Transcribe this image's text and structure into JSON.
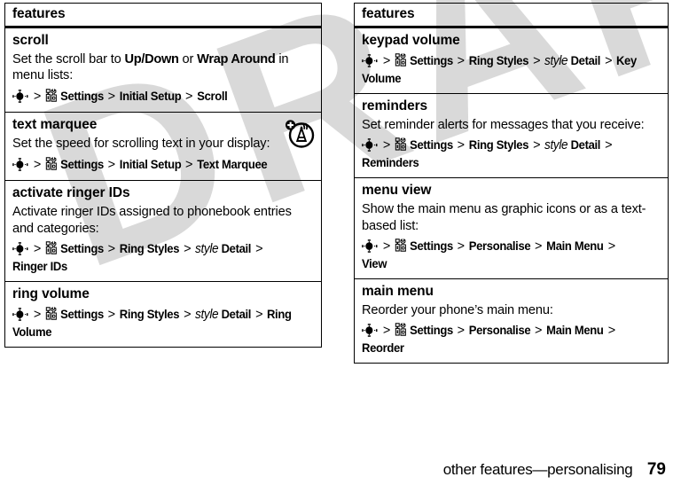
{
  "watermark": {
    "text": "DRAFT"
  },
  "footer": {
    "chapter": "other features—personalising",
    "page_number": "79"
  },
  "icons": {
    "nav_key": "navigation-key-icon",
    "settings": "settings-tools-icon",
    "corner_antenna": "ringer-id-antenna-icon"
  },
  "columns": [
    {
      "header": "features",
      "rows": [
        {
          "title": "scroll",
          "desc_parts": [
            {
              "t": "Set the scroll bar to ",
              "bold": false
            },
            {
              "t": "Up/Down",
              "bold": true
            },
            {
              "t": " or ",
              "bold": false
            },
            {
              "t": "Wrap Around",
              "bold": true
            },
            {
              "t": " in menu lists:",
              "bold": false
            }
          ],
          "path": [
            {
              "type": "navicon"
            },
            {
              "type": "sep",
              "t": ">"
            },
            {
              "type": "toolsicon"
            },
            {
              "type": "label",
              "t": "Settings"
            },
            {
              "type": "sep",
              "t": ">"
            },
            {
              "type": "label",
              "t": "Initial Setup"
            },
            {
              "type": "sep",
              "t": ">"
            },
            {
              "type": "label",
              "t": "Scroll"
            }
          ],
          "corner_icon": false
        },
        {
          "title": "text marquee",
          "desc_parts": [
            {
              "t": "Set the speed for scrolling text in your display:",
              "bold": false
            }
          ],
          "path": [
            {
              "type": "navicon"
            },
            {
              "type": "sep",
              "t": ">"
            },
            {
              "type": "toolsicon"
            },
            {
              "type": "label",
              "t": "Settings"
            },
            {
              "type": "sep",
              "t": ">"
            },
            {
              "type": "label",
              "t": "Initial Setup"
            },
            {
              "type": "sep",
              "t": ">"
            },
            {
              "type": "label",
              "t": "Text Marquee"
            }
          ],
          "corner_icon": true
        },
        {
          "title": "activate ringer IDs",
          "desc_parts": [
            {
              "t": "Activate ringer IDs assigned to phonebook entries and categories:",
              "bold": false
            }
          ],
          "path": [
            {
              "type": "navicon"
            },
            {
              "type": "sep",
              "t": ">"
            },
            {
              "type": "toolsicon"
            },
            {
              "type": "label",
              "t": "Settings"
            },
            {
              "type": "sep",
              "t": ">"
            },
            {
              "type": "label",
              "t": "Ring Styles"
            },
            {
              "type": "sep",
              "t": ">"
            },
            {
              "type": "italic",
              "t": "style"
            },
            {
              "type": "label",
              "t": "Detail"
            },
            {
              "type": "sep",
              "t": ">"
            },
            {
              "type": "label",
              "t": "Ringer IDs"
            }
          ],
          "corner_icon": false
        },
        {
          "title": "ring volume",
          "desc_parts": [],
          "path": [
            {
              "type": "navicon"
            },
            {
              "type": "sep",
              "t": ">"
            },
            {
              "type": "toolsicon"
            },
            {
              "type": "label",
              "t": "Settings"
            },
            {
              "type": "sep",
              "t": ">"
            },
            {
              "type": "label",
              "t": "Ring Styles"
            },
            {
              "type": "sep",
              "t": ">"
            },
            {
              "type": "italic",
              "t": "style"
            },
            {
              "type": "label",
              "t": "Detail"
            },
            {
              "type": "sep",
              "t": ">"
            },
            {
              "type": "label",
              "t": "Ring Volume"
            }
          ],
          "corner_icon": false
        }
      ]
    },
    {
      "header": "features",
      "rows": [
        {
          "title": "keypad volume",
          "desc_parts": [],
          "path": [
            {
              "type": "navicon"
            },
            {
              "type": "sep",
              "t": ">"
            },
            {
              "type": "toolsicon"
            },
            {
              "type": "label",
              "t": "Settings"
            },
            {
              "type": "sep",
              "t": ">"
            },
            {
              "type": "label",
              "t": "Ring Styles"
            },
            {
              "type": "sep",
              "t": ">"
            },
            {
              "type": "italic",
              "t": "style"
            },
            {
              "type": "label",
              "t": "Detail"
            },
            {
              "type": "sep",
              "t": ">"
            },
            {
              "type": "label",
              "t": "Key Volume"
            }
          ],
          "corner_icon": false
        },
        {
          "title": "reminders",
          "desc_parts": [
            {
              "t": "Set reminder alerts for messages that you receive:",
              "bold": false
            }
          ],
          "path": [
            {
              "type": "navicon"
            },
            {
              "type": "sep",
              "t": ">"
            },
            {
              "type": "toolsicon"
            },
            {
              "type": "label",
              "t": "Settings"
            },
            {
              "type": "sep",
              "t": ">"
            },
            {
              "type": "label",
              "t": "Ring Styles"
            },
            {
              "type": "sep",
              "t": ">"
            },
            {
              "type": "italic",
              "t": "style"
            },
            {
              "type": "label",
              "t": "Detail"
            },
            {
              "type": "sep",
              "t": ">"
            },
            {
              "type": "label",
              "t": "Reminders"
            }
          ],
          "corner_icon": false
        },
        {
          "title": "menu view",
          "desc_parts": [
            {
              "t": "Show the main menu as graphic icons or as a text-based list:",
              "bold": false
            }
          ],
          "path": [
            {
              "type": "navicon"
            },
            {
              "type": "sep",
              "t": ">"
            },
            {
              "type": "toolsicon"
            },
            {
              "type": "label",
              "t": "Settings"
            },
            {
              "type": "sep",
              "t": ">"
            },
            {
              "type": "label",
              "t": "Personalise"
            },
            {
              "type": "sep",
              "t": ">"
            },
            {
              "type": "label",
              "t": "Main Menu"
            },
            {
              "type": "sep",
              "t": ">"
            },
            {
              "type": "label",
              "t": "View"
            }
          ],
          "corner_icon": false
        },
        {
          "title": "main menu",
          "desc_parts": [
            {
              "t": "Reorder your phone’s main menu:",
              "bold": false
            }
          ],
          "path": [
            {
              "type": "navicon"
            },
            {
              "type": "sep",
              "t": ">"
            },
            {
              "type": "toolsicon"
            },
            {
              "type": "label",
              "t": "Settings"
            },
            {
              "type": "sep",
              "t": ">"
            },
            {
              "type": "label",
              "t": "Personalise"
            },
            {
              "type": "sep",
              "t": ">"
            },
            {
              "type": "label",
              "t": "Main Menu"
            },
            {
              "type": "sep",
              "t": ">"
            },
            {
              "type": "label",
              "t": "Reorder"
            }
          ],
          "corner_icon": false
        }
      ]
    }
  ]
}
